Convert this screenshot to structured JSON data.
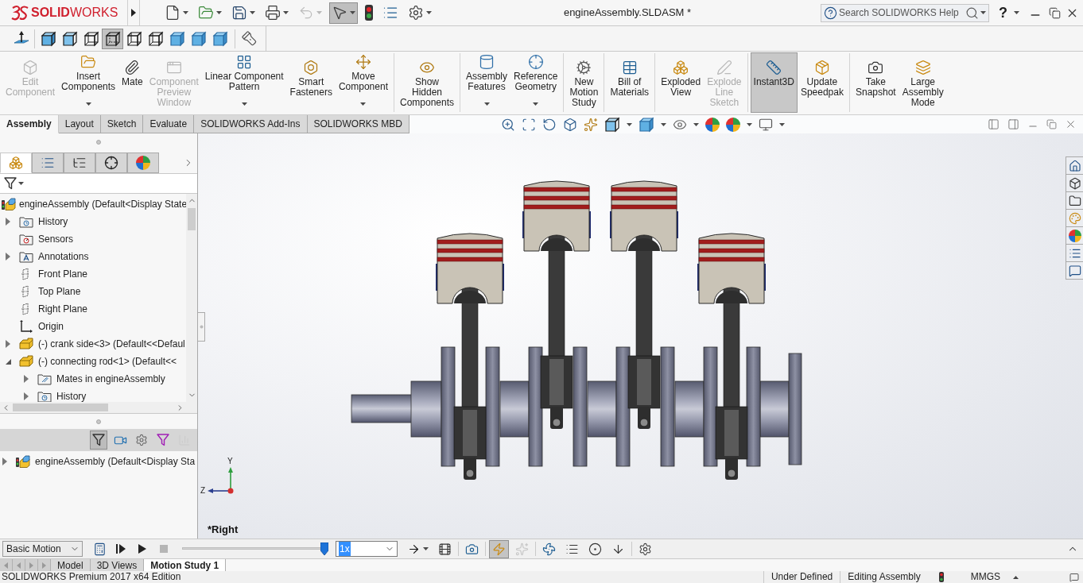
{
  "title_bar": {
    "logo": "**SOLID**WORKS",
    "document_title": "engineAssembly.SLDASM *",
    "help_search": {
      "placeholder": "Search SOLIDWORKS Help"
    },
    "help_button": "?"
  },
  "quick_access": [
    {
      "dropdown": true,
      "selected": false,
      "disabled": false
    },
    {
      "dropdown": true,
      "selected": false,
      "disabled": false
    },
    {
      "dropdown": true,
      "selected": false,
      "disabled": false
    },
    {
      "dropdown": true,
      "selected": false,
      "disabled": false
    },
    {
      "dropdown": true,
      "selected": false,
      "disabled": true
    },
    {
      "dropdown": true,
      "selected": true,
      "disabled": false
    },
    {
      "dropdown": false,
      "selected": false,
      "disabled": false
    },
    {
      "dropdown": false,
      "selected": false,
      "disabled": false
    },
    {
      "dropdown": true,
      "selected": false,
      "disabled": false
    }
  ],
  "view_toolbar": [
    {
      "selected": false
    },
    {
      "selected": false
    },
    {
      "selected": false
    },
    {
      "selected": false
    },
    {
      "selected": true
    },
    {
      "selected": false
    },
    {
      "selected": false
    },
    {
      "selected": false
    },
    {
      "selected": false
    },
    {
      "selected": false
    },
    {
      "selected": false
    }
  ],
  "ribbon_groups": [
    [
      {
        "label": "Edit\nComponent",
        "disabled": true,
        "selected": false,
        "dropdown": false
      },
      {
        "label": "Insert\nComponents",
        "disabled": false,
        "selected": false,
        "dropdown": true
      },
      {
        "label": "Mate",
        "disabled": false,
        "selected": false,
        "dropdown": false
      },
      {
        "label": "Component\nPreview\nWindow",
        "disabled": true,
        "selected": false,
        "dropdown": false
      },
      {
        "label": "Linear Component\nPattern",
        "disabled": false,
        "selected": false,
        "dropdown": true
      },
      {
        "label": "Smart\nFasteners",
        "disabled": false,
        "selected": false,
        "dropdown": false
      },
      {
        "label": "Move\nComponent",
        "disabled": false,
        "selected": false,
        "dropdown": true
      }
    ],
    [
      {
        "label": "Show\nHidden\nComponents",
        "disabled": false,
        "selected": false,
        "dropdown": false
      }
    ],
    [
      {
        "label": "Assembly\nFeatures",
        "disabled": false,
        "selected": false,
        "dropdown": true
      },
      {
        "label": "Reference\nGeometry",
        "disabled": false,
        "selected": false,
        "dropdown": true
      }
    ],
    [
      {
        "label": "New\nMotion\nStudy",
        "disabled": false,
        "selected": false,
        "dropdown": false
      }
    ],
    [
      {
        "label": "Bill of\nMaterials",
        "disabled": false,
        "selected": false,
        "dropdown": false
      }
    ],
    [
      {
        "label": "Exploded\nView",
        "disabled": false,
        "selected": false,
        "dropdown": false
      },
      {
        "label": "Explode\nLine\nSketch",
        "disabled": true,
        "selected": false,
        "dropdown": false
      }
    ],
    [
      {
        "label": "Instant3D",
        "disabled": false,
        "selected": true,
        "dropdown": false
      },
      {
        "label": "Update\nSpeedpak",
        "disabled": false,
        "selected": false,
        "dropdown": false
      }
    ],
    [
      {
        "label": "Take\nSnapshot",
        "disabled": false,
        "selected": false,
        "dropdown": false
      },
      {
        "label": "Large\nAssembly\nMode",
        "disabled": false,
        "selected": false,
        "dropdown": false
      }
    ]
  ],
  "command_tabs": [
    {
      "label": "Assembly",
      "selected": true
    },
    {
      "label": "Layout",
      "selected": false
    },
    {
      "label": "Sketch",
      "selected": false
    },
    {
      "label": "Evaluate",
      "selected": false
    },
    {
      "label": "SOLIDWORKS Add-Ins",
      "selected": false
    },
    {
      "label": "SOLIDWORKS MBD",
      "selected": false
    }
  ],
  "feature_manager": {
    "tabs": [
      {
        "selected": true
      },
      {
        "selected": false
      },
      {
        "selected": false
      },
      {
        "selected": false
      },
      {
        "selected": false
      }
    ],
    "tree": [
      {
        "kind": "assembly",
        "label": "engineAssembly (Default<Display State",
        "children": [
          {
            "kind": "history",
            "label": "History",
            "expanded": false
          },
          {
            "kind": "sensors",
            "label": "Sensors"
          },
          {
            "kind": "annotations",
            "label": "Annotations",
            "expanded": false
          },
          {
            "kind": "plane",
            "label": "Front Plane"
          },
          {
            "kind": "plane",
            "label": "Top Plane"
          },
          {
            "kind": "plane",
            "label": "Right Plane"
          },
          {
            "kind": "origin",
            "label": "Origin"
          },
          {
            "kind": "part",
            "label": "(-) crank side<3> (Default<<Defaul",
            "expanded": false
          },
          {
            "kind": "part",
            "label": "(-) connecting rod<1> (Default<<",
            "expanded": true,
            "children": [
              {
                "kind": "mates",
                "label": "Mates in engineAssembly",
                "expanded": false
              },
              {
                "kind": "history",
                "label": "History",
                "expanded": false
              }
            ]
          }
        ]
      }
    ],
    "lower_toolbar": [
      {
        "selected": true,
        "disabled": false
      },
      {
        "selected": false,
        "disabled": false
      },
      {
        "selected": false,
        "disabled": false
      },
      {
        "selected": false,
        "disabled": false
      },
      {
        "selected": false,
        "disabled": true
      }
    ],
    "lower_tree": [
      {
        "kind": "assembly",
        "label": "engineAssembly (Default<Display Sta",
        "expanded": false
      }
    ]
  },
  "viewport": {
    "view_name": "*Right",
    "triad": {
      "y_label": "Y",
      "z_label": "Z"
    }
  },
  "motion_manager": {
    "study_type": "Basic Motion",
    "playback": [
      {
        "disabled": false
      },
      {
        "disabled": false
      },
      {
        "disabled": false
      },
      {
        "disabled": true
      }
    ],
    "timeline": {
      "level": 1
    },
    "playback_speed": {
      "value": "1x",
      "highlighted": true
    },
    "tools": [
      {
        "dropdown": true,
        "selected": false,
        "disabled": false
      },
      {
        "dropdown": false,
        "selected": false,
        "disabled": false
      },
      {
        "dropdown": false,
        "selected": false,
        "disabled": false
      },
      {
        "dropdown": false,
        "selected": true,
        "disabled": false
      },
      {
        "dropdown": false,
        "selected": false,
        "disabled": true
      },
      {
        "dropdown": false,
        "selected": false,
        "disabled": false
      },
      {
        "dropdown": false,
        "selected": false,
        "disabled": false
      },
      {
        "dropdown": false,
        "selected": false,
        "disabled": false
      },
      {
        "dropdown": false,
        "selected": false,
        "disabled": false
      },
      {
        "dropdown": false,
        "selected": false,
        "disabled": false
      }
    ],
    "tabs": [
      {
        "label": "Model",
        "selected": false
      },
      {
        "label": "3D Views",
        "selected": false
      },
      {
        "label": "Motion Study 1",
        "selected": true
      }
    ]
  },
  "status_bar": {
    "edition": "SOLIDWORKS Premium 2017 x64 Edition",
    "fields": [
      "Under Defined",
      "Editing Assembly"
    ],
    "units": "MMGS"
  }
}
